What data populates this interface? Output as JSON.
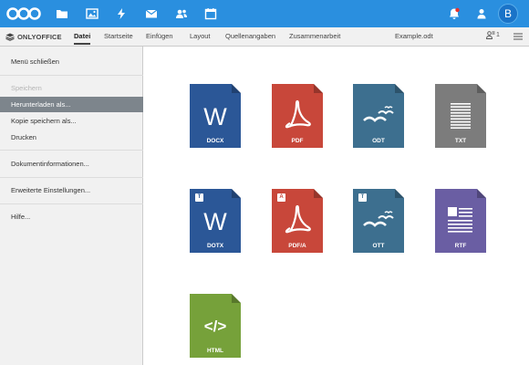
{
  "topbar": {
    "avatar_letter": "B",
    "apps": [
      "files-icon",
      "photos-icon",
      "activity-icon",
      "mail-icon",
      "contacts-icon",
      "calendar-icon"
    ]
  },
  "toolbar": {
    "brand": "ONLYOFFICE",
    "tabs": [
      "Datei",
      "Startseite",
      "Einfügen",
      "Layout",
      "Quellenangaben",
      "Zusammenarbeit"
    ],
    "active_tab": "Datei",
    "document_title": "Example.odt",
    "users_count": "1"
  },
  "file_menu": {
    "items": [
      {
        "label": "Menü schließen",
        "state": "normal"
      },
      {
        "label": "Speichern",
        "state": "disabled"
      },
      {
        "label": "Herunterladen als...",
        "state": "selected"
      },
      {
        "label": "Kopie speichern als...",
        "state": "normal"
      },
      {
        "label": "Drucken",
        "state": "normal"
      },
      {
        "label": "Dokumentinformationen...",
        "state": "normal"
      },
      {
        "label": "Erweiterte Einstellungen...",
        "state": "normal"
      },
      {
        "label": "Hilfe...",
        "state": "normal"
      }
    ]
  },
  "formats": [
    {
      "label": "DOCX",
      "color": "#2b5797",
      "glyph": "W",
      "template": false
    },
    {
      "label": "PDF",
      "color": "#c8473a",
      "glyph": "pdf",
      "template": false
    },
    {
      "label": "ODT",
      "color": "#3d6f8f",
      "glyph": "gulls",
      "template": false
    },
    {
      "label": "TXT",
      "color": "#7c7c7c",
      "glyph": "lines",
      "template": false
    },
    {
      "label": "DOTX",
      "color": "#2b5797",
      "glyph": "W",
      "template": true,
      "badge": "T"
    },
    {
      "label": "PDF/A",
      "color": "#c8473a",
      "glyph": "pdf",
      "template": true,
      "badge": "A"
    },
    {
      "label": "OTT",
      "color": "#3d6f8f",
      "glyph": "gulls",
      "template": true,
      "badge": "T"
    },
    {
      "label": "RTF",
      "color": "#6a5ea3",
      "glyph": "rtf",
      "template": false
    },
    {
      "label": "HTML",
      "color": "#76a13a",
      "glyph": "html",
      "template": false
    }
  ],
  "html_glyph_text": "</>"
}
